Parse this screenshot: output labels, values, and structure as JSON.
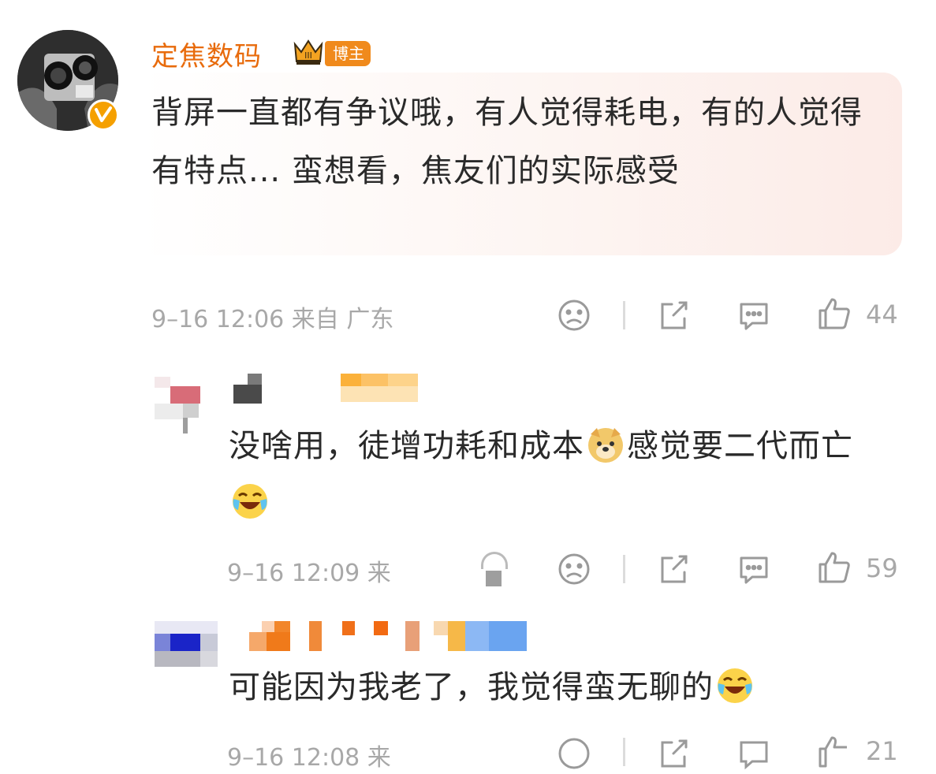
{
  "comment": {
    "username": "定焦数码",
    "badge_label": "博主",
    "text": "背屏一直都有争议哦，有人觉得耗电，有的人觉得有特点... 蛮想看，焦友们的实际感受",
    "meta": "9–16 12:06  来自 广东",
    "likes": "44"
  },
  "replies": [
    {
      "text_a": "没啥用，徒增功耗和成本",
      "text_b": "感觉要二代而亡",
      "emoji_1": "doge-icon",
      "emoji_2": "laugh-cry-icon",
      "meta": "9–16 12:09 来",
      "likes": "59"
    },
    {
      "text_a": "可能因为我老了，我觉得蛮无聊的",
      "emoji_1": "laugh-cry-icon",
      "meta": "9–16 12:08 来",
      "likes": "21"
    }
  ],
  "colors": {
    "username": "#e86b0c",
    "badge": "#f08a1c",
    "meta": "#a8a8a8"
  }
}
